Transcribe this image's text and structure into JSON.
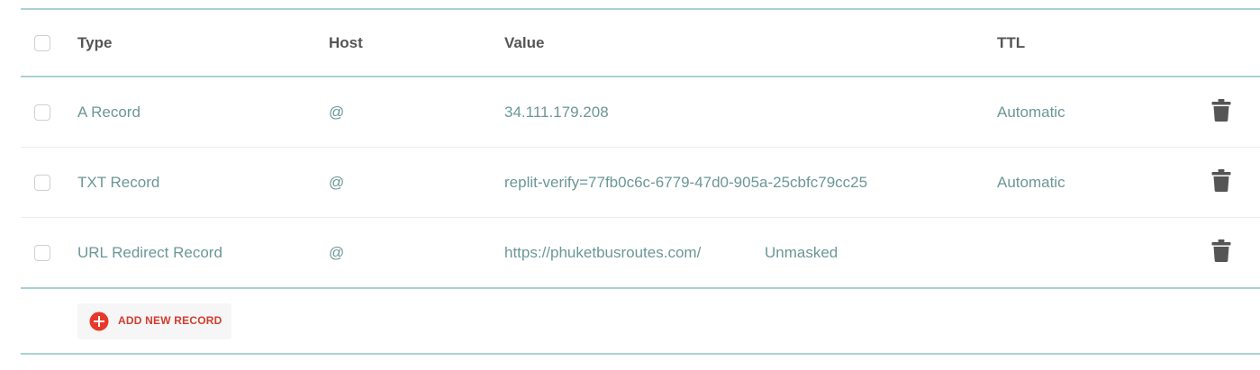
{
  "header": {
    "type": "Type",
    "host": "Host",
    "value": "Value",
    "ttl": "TTL"
  },
  "records": [
    {
      "type": "A Record",
      "host": "@",
      "value": "34.111.179.208",
      "extra": "",
      "ttl": "Automatic"
    },
    {
      "type": "TXT Record",
      "host": "@",
      "value": "replit-verify=77fb0c6c-6779-47d0-905a-25cbfc79cc25",
      "extra": "",
      "ttl": "Automatic"
    },
    {
      "type": "URL Redirect Record",
      "host": "@",
      "value": "https://phuketbusroutes.com/",
      "extra": "Unmasked",
      "ttl": ""
    }
  ],
  "actions": {
    "add_label": "ADD NEW RECORD"
  },
  "colors": {
    "accent_line": "#a9d2d0",
    "value_text": "#6b9796",
    "add_button": "#e8382a",
    "trash_icon": "#555555"
  },
  "icons": {
    "delete": "trash-icon",
    "add": "plus-circle-icon"
  }
}
